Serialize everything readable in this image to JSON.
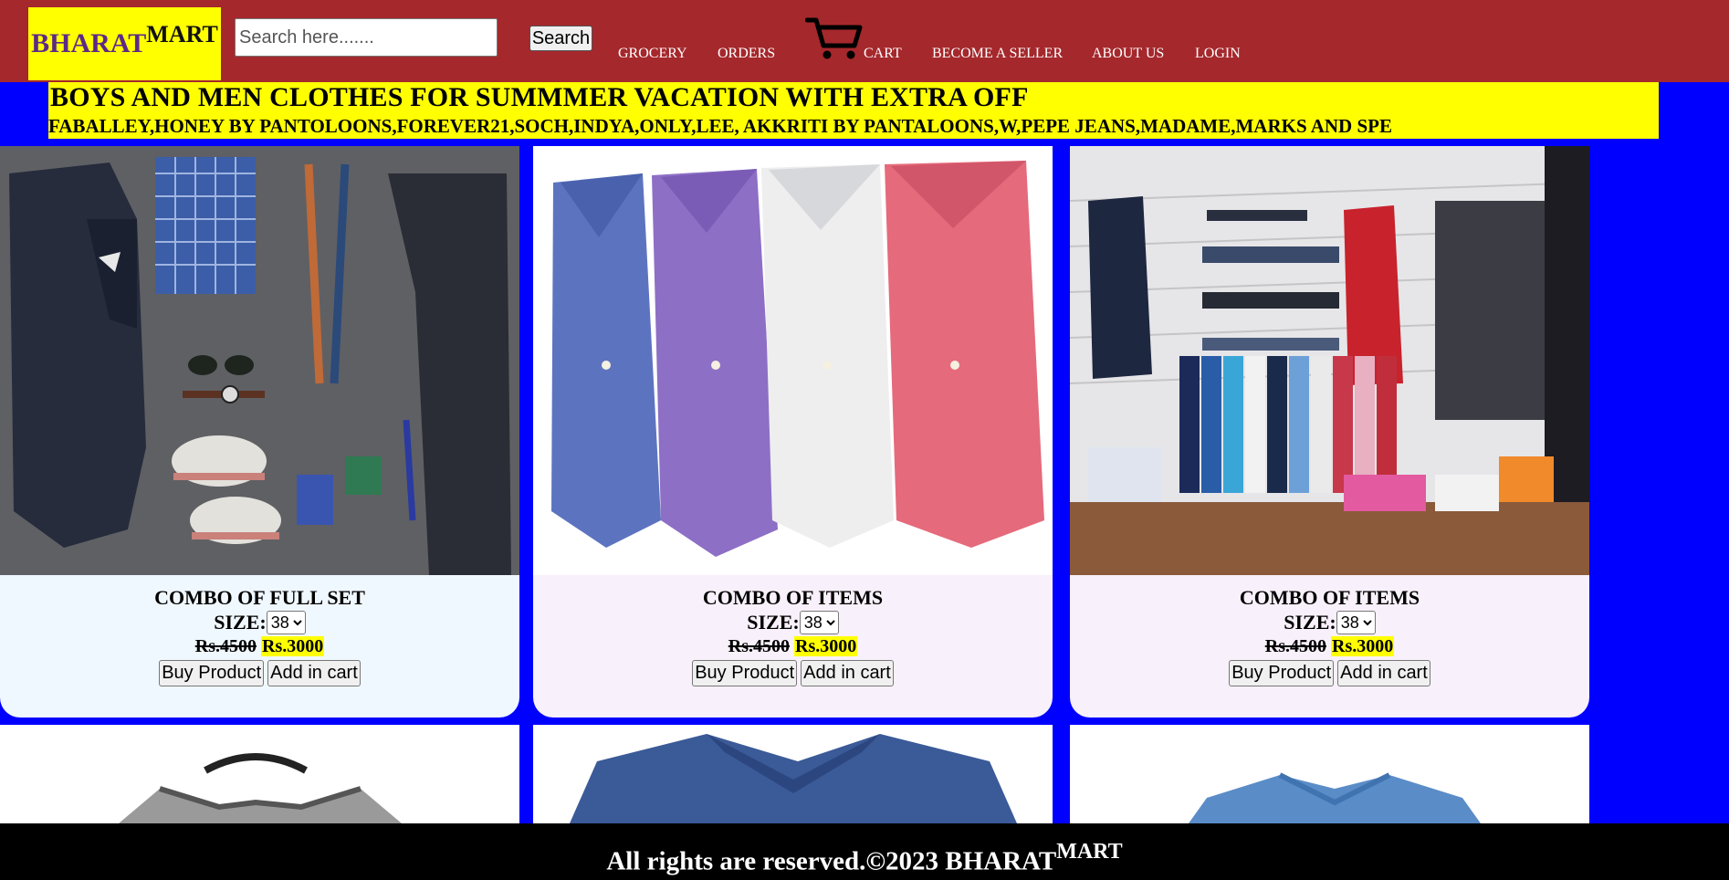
{
  "header": {
    "logo": {
      "part1": "BHARAT",
      "part2": "MART"
    },
    "search": {
      "placeholder": "Search here.......",
      "value": "",
      "button_label": "Search"
    },
    "nav": {
      "grocery": "GROCERY",
      "orders": "ORDERS",
      "cart": "CART",
      "seller": "BECOME A SELLER",
      "about": "ABOUT US",
      "login": "LOGIN"
    }
  },
  "banner": {
    "title": "BOYS AND MEN CLOTHES FOR SUMMMER VACATION WITH EXTRA OFF",
    "brands": "FABALLEY,HONEY BY PANTOLOONS,FOREVER21,SOCH,INDYA,ONLY,LEE, AKKRITI BY PANTALOONS,W,PEPE JEANS,MADAME,MARKS AND SPE"
  },
  "products": [
    {
      "name": "COMBO OF FULL SET",
      "size_label": "SIZE:",
      "size_value": "38",
      "old_price": "Rs.4500",
      "new_price": "Rs.3000",
      "buy_label": "Buy Product",
      "cart_label": "Add in cart"
    },
    {
      "name": "COMBO OF ITEMS",
      "size_label": "SIZE:",
      "size_value": "38",
      "old_price": "Rs.4500",
      "new_price": "Rs.3000",
      "buy_label": "Buy Product",
      "cart_label": "Add in cart"
    },
    {
      "name": "COMBO OF ITEMS",
      "size_label": "SIZE:",
      "size_value": "38",
      "old_price": "Rs.4500",
      "new_price": "Rs.3000",
      "buy_label": "Buy Product",
      "cart_label": "Add in cart"
    }
  ],
  "footer": {
    "text": "All rights are reserved.©2023 BHARAT",
    "sup": "MART"
  },
  "colors": {
    "header_bg": "#a5282c",
    "page_bg": "#0000ff",
    "accent_yellow": "#ffff00",
    "logo_text": "#5b2a86",
    "card1_bg": "#f0f8ff",
    "card2_bg": "#f8f0fa",
    "card3_bg": "#f8f0fa"
  }
}
